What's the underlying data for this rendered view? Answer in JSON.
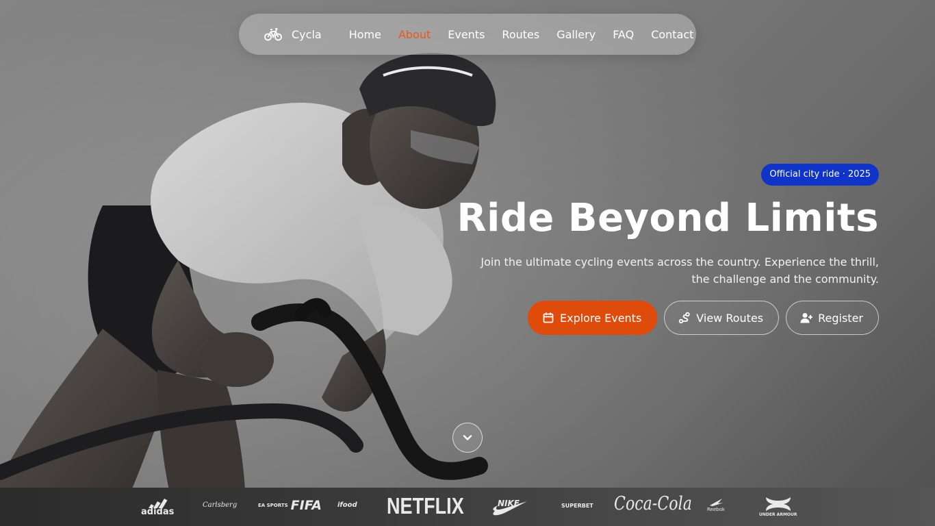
{
  "nav": {
    "brand": "Cycla",
    "brand_icon": "bicycle-icon",
    "links": [
      "Home",
      "About",
      "Events",
      "Routes",
      "Gallery",
      "FAQ",
      "Contact"
    ],
    "active": "About"
  },
  "hero": {
    "badge": "Official city ride · 2025",
    "title": "Ride Beyond Limits",
    "subtitle": "Join the ultimate cycling events across the country. Experience the thrill, the challenge and the community.",
    "buttons": [
      {
        "label": "Explore Events",
        "icon": "calendar-icon"
      },
      {
        "label": "View Routes",
        "icon": "route-icon"
      },
      {
        "label": "Register",
        "icon": "user-plus-icon"
      }
    ],
    "scroll_icon": "chevron-down-icon"
  },
  "sponsors": {
    "adidas": "adidas",
    "carlsberg": "Carlsberg",
    "ea_sports": "EA SPORTS",
    "fifa": "FIFA",
    "ifood": "ifood",
    "netflix": "NETFLIX",
    "nike": "NIKE",
    "superbet": "SUPERBET",
    "cocacola": "Coca-Cola",
    "reebok": "Reebok",
    "under_armour": "UNDER ARMOUR"
  },
  "colors": {
    "accent": "#df4b0b",
    "nav_active": "#e8591c",
    "badge_bg": "#1033c8"
  }
}
